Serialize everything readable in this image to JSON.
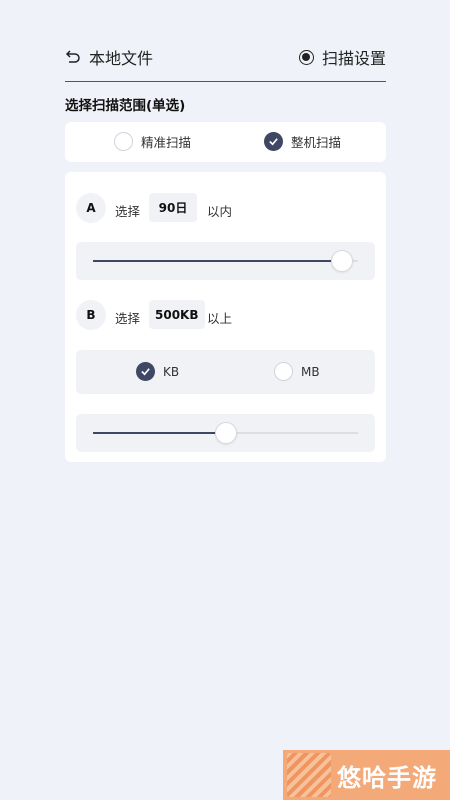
{
  "header": {
    "back_label": "本地文件",
    "scan_settings_label": "扫描设置"
  },
  "scan_range": {
    "title": "选择扫描范围(单选)",
    "options": [
      {
        "label": "精准扫描",
        "selected": false
      },
      {
        "label": "整机扫描",
        "selected": true
      }
    ]
  },
  "filter_a": {
    "badge": "A",
    "prefix": "选择",
    "value": "90日",
    "suffix": "以内",
    "slider_fraction": 0.94
  },
  "filter_b": {
    "badge": "B",
    "prefix": "选择",
    "value": "500KB",
    "suffix": "以上",
    "slider_fraction": 0.5,
    "units": [
      {
        "label": "KB",
        "selected": true
      },
      {
        "label": "MB",
        "selected": false
      }
    ]
  },
  "watermark": {
    "text": "悠哈手游"
  },
  "colors": {
    "accent": "#3e4763",
    "background": "#eff2f8",
    "card": "#ffffff"
  }
}
